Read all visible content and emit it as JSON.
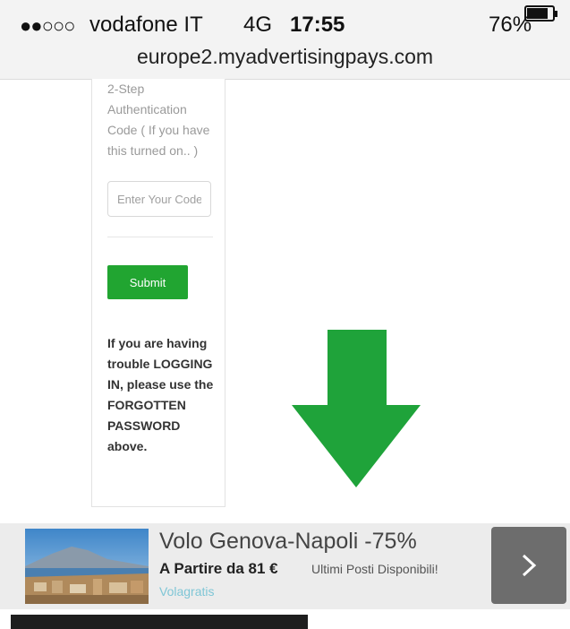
{
  "status_bar": {
    "signal": "●●○○○",
    "carrier": "vodafone IT",
    "network": "4G",
    "time": "17:55",
    "battery_percent": "76%",
    "battery_level": 0.76
  },
  "browser": {
    "url": "europe2.myadvertisingpays.com"
  },
  "login": {
    "tfa_label": "2-Step Authentication Code ( If you have this turned on.. )",
    "tfa_placeholder": "Enter Your Code",
    "submit_label": "Submit",
    "trouble_text": "If you are having trouble LOGGING IN, please use the FORGOTTEN PASSWORD above."
  },
  "ad": {
    "title": "Volo Genova-Napoli -75%",
    "price": "A Partire da 81 €",
    "subtitle": "Ultimi Posti Disponibili!",
    "brand": "Volagratis",
    "next_icon": "chevron-right-icon"
  },
  "colors": {
    "submit_green": "#21a531",
    "arrow_green": "#1fa33a",
    "ad_next_gray": "#6d6d6d",
    "brand_link": "#7fc6d6"
  },
  "icons": {
    "arrow": "arrow-down-icon"
  }
}
